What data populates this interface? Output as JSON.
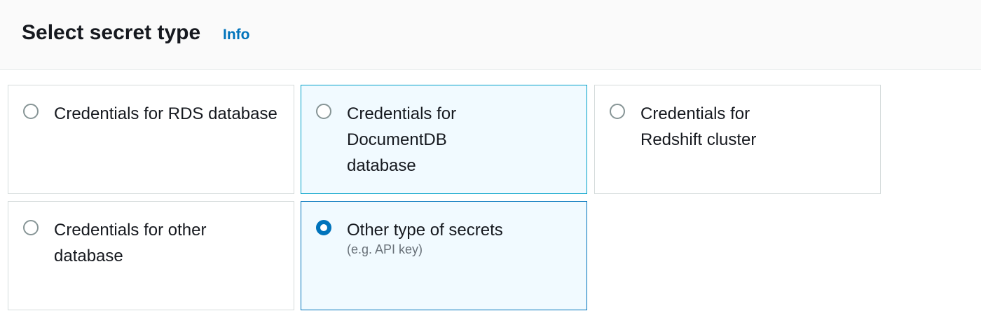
{
  "section": {
    "title": "Select secret type",
    "info_link": "Info"
  },
  "options": [
    {
      "label": "Credentials for RDS database",
      "selected": false
    },
    {
      "label": "Credentials for DocumentDB database",
      "selected": false
    },
    {
      "label": "Credentials for Redshift cluster",
      "selected": false
    },
    {
      "label": "Credentials for other database",
      "selected": false
    },
    {
      "label": "Other type of secrets",
      "description": "(e.g. API key)",
      "selected": true
    }
  ]
}
